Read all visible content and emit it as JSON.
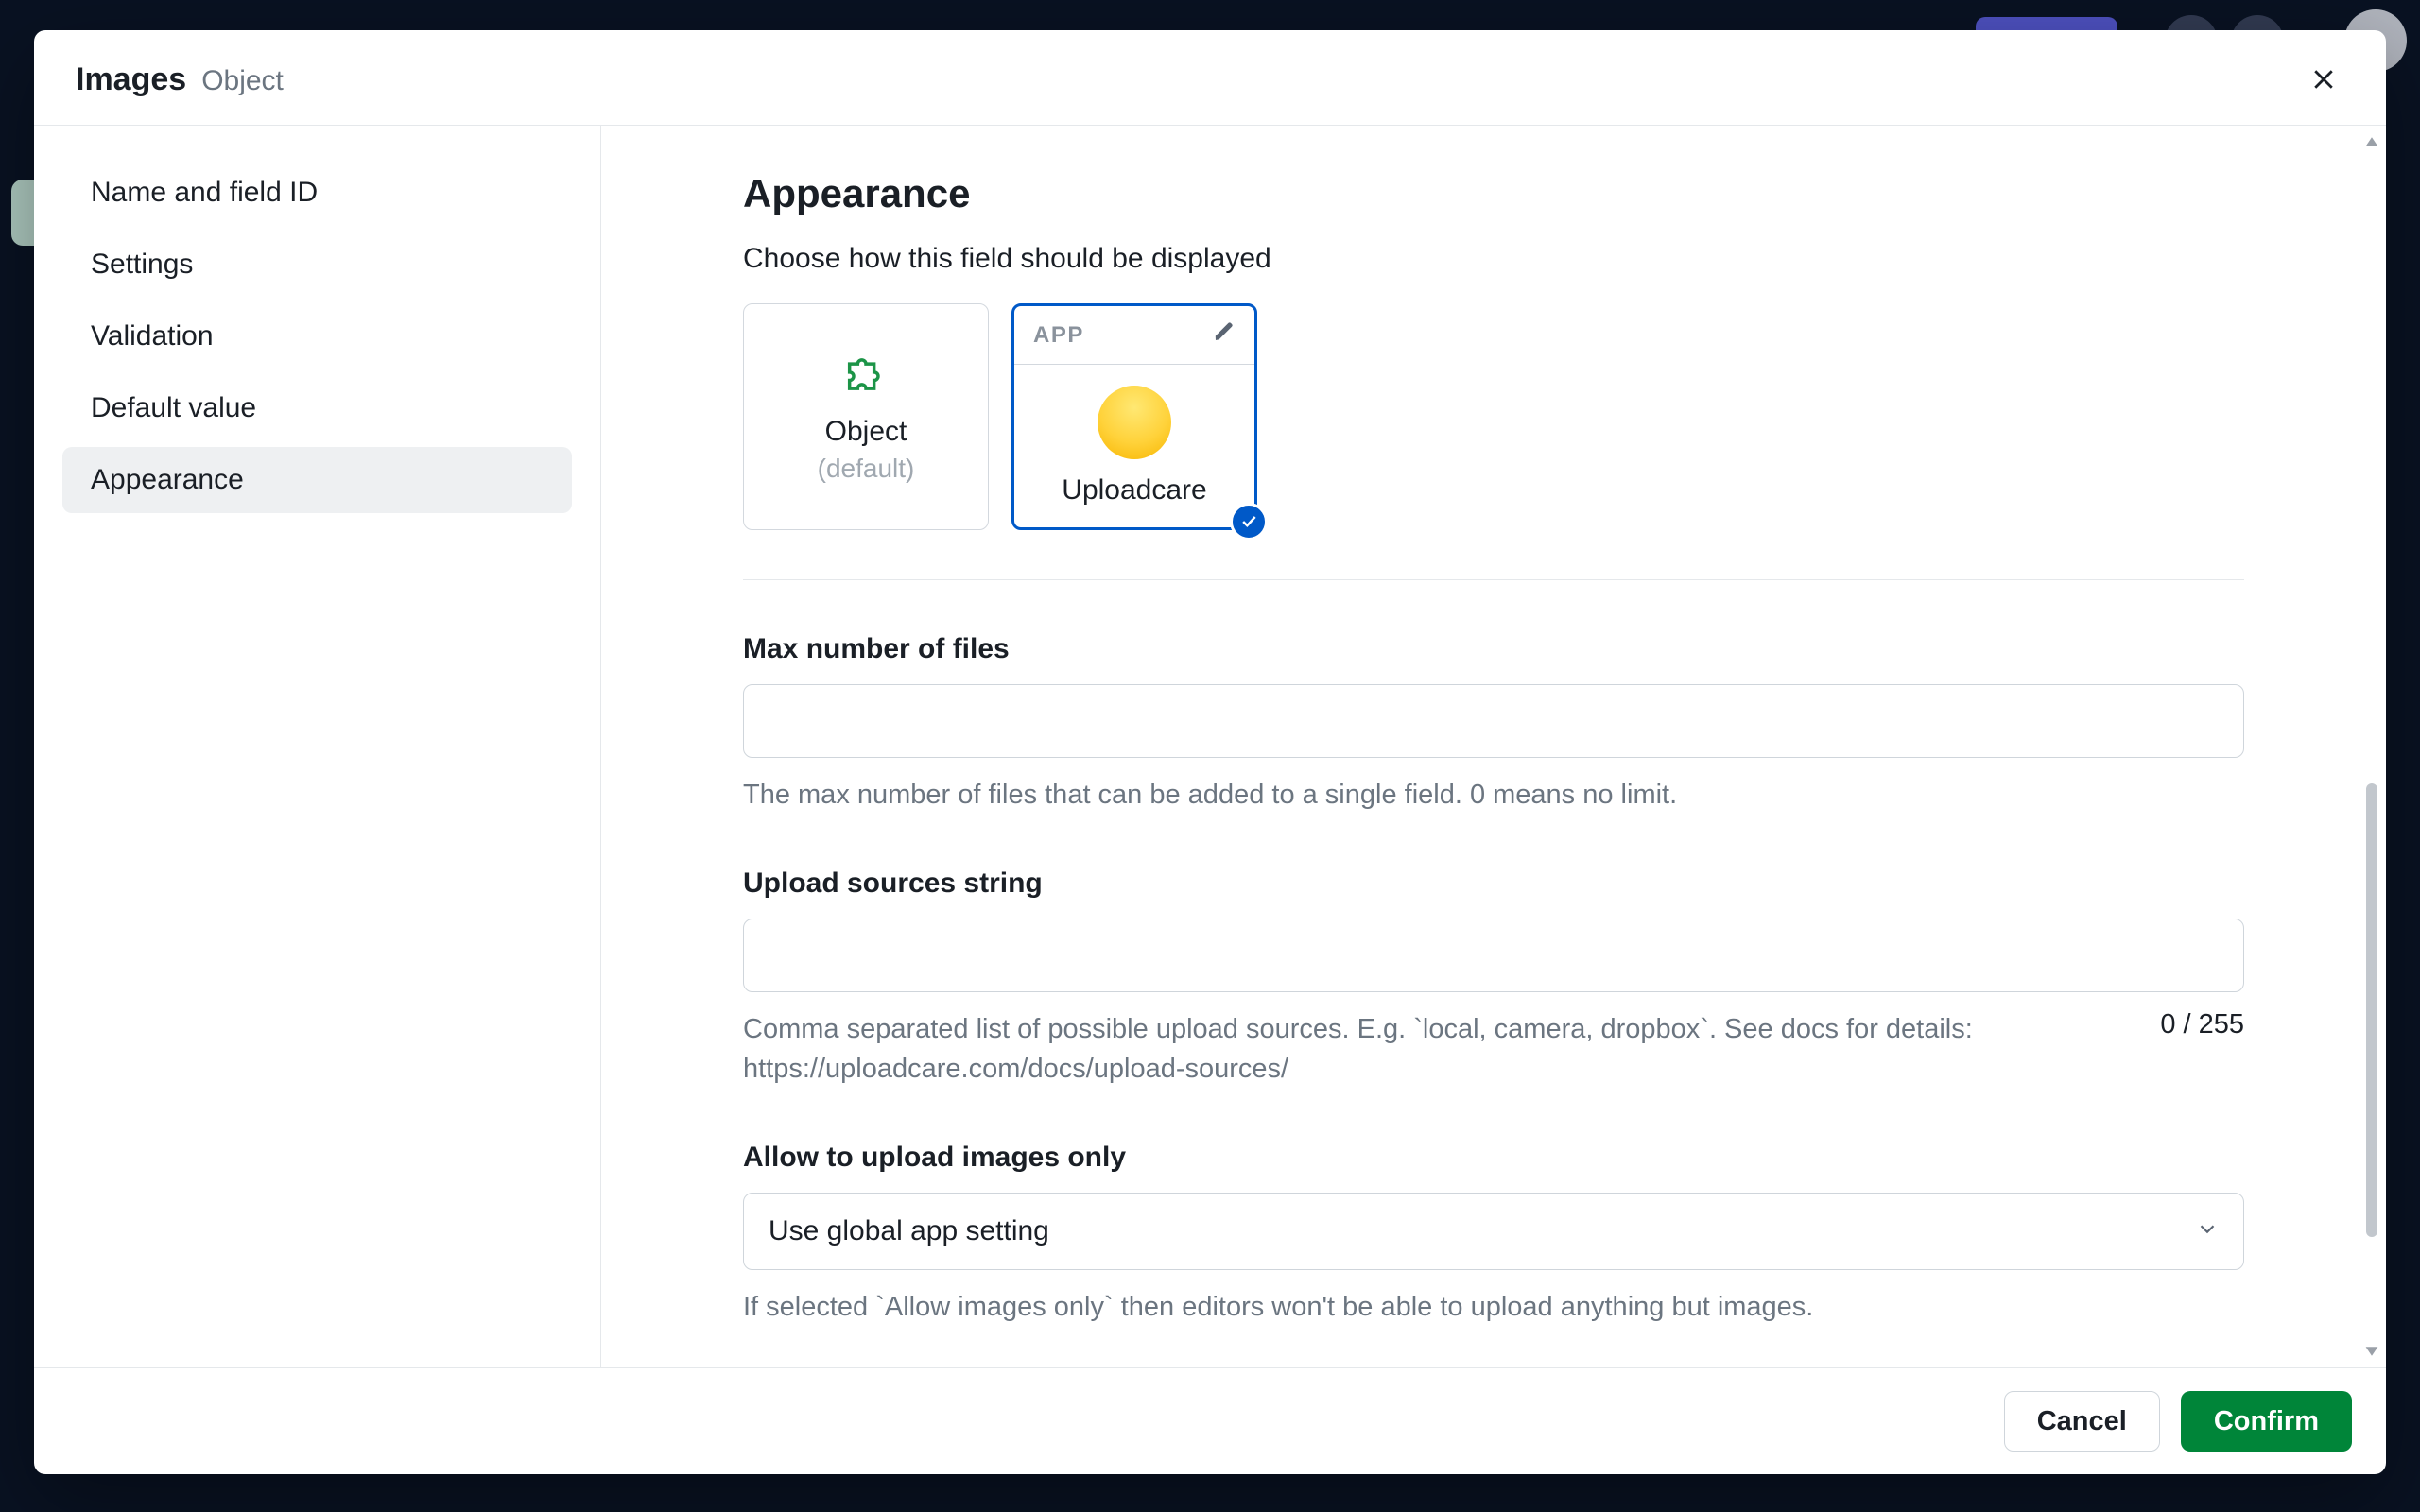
{
  "header": {
    "title": "Images",
    "subtitle": "Object"
  },
  "sidebar": {
    "items": [
      {
        "label": "Name and field ID"
      },
      {
        "label": "Settings"
      },
      {
        "label": "Validation"
      },
      {
        "label": "Default value"
      },
      {
        "label": "Appearance"
      }
    ]
  },
  "main": {
    "section_title": "Appearance",
    "section_desc": "Choose how this field should be displayed",
    "cards": {
      "default": {
        "label": "Object",
        "sublabel": "(default)"
      },
      "app": {
        "badge": "APP",
        "label": "Uploadcare"
      }
    },
    "fields": {
      "max_files": {
        "label": "Max number of files",
        "value": "",
        "help": "The max number of files that can be added to a single field. 0 means no limit."
      },
      "upload_sources": {
        "label": "Upload sources string",
        "value": "",
        "help": "Comma separated list of possible upload sources. E.g. `local, camera, dropbox`. See docs for details: https://uploadcare.com/docs/upload-sources/",
        "char_count": "0 / 255"
      },
      "images_only": {
        "label": "Allow to upload images only",
        "value": "Use global app setting",
        "help": "If selected `Allow images only` then editors won't be able to upload anything but images."
      }
    }
  },
  "footer": {
    "cancel": "Cancel",
    "confirm": "Confirm"
  }
}
